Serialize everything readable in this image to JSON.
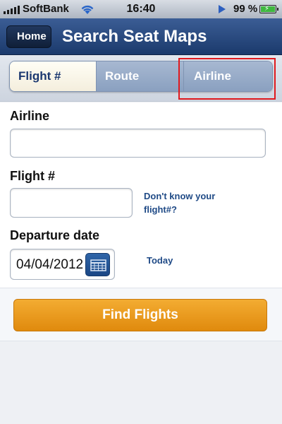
{
  "status_bar": {
    "carrier": "SoftBank",
    "time": "16:40",
    "battery_percent": "99 %"
  },
  "nav": {
    "back_label": "Home",
    "title": "Search Seat Maps"
  },
  "tabs": [
    {
      "label": "Flight #",
      "selected": true
    },
    {
      "label": "Route",
      "selected": false
    },
    {
      "label": "Airline",
      "selected": false
    }
  ],
  "form": {
    "airline_label": "Airline",
    "airline_value": "",
    "flight_label": "Flight #",
    "flight_value": "",
    "help_link": "Don't know your flight#?",
    "date_label": "Departure date",
    "date_value": "04/04/2012",
    "today_link": "Today"
  },
  "actions": {
    "find_flights": "Find Flights"
  },
  "colors": {
    "nav_bar": "#1b3a6c",
    "accent_orange": "#e08a0d",
    "link_blue": "#1f4a86",
    "highlight_red": "#e0191e"
  }
}
